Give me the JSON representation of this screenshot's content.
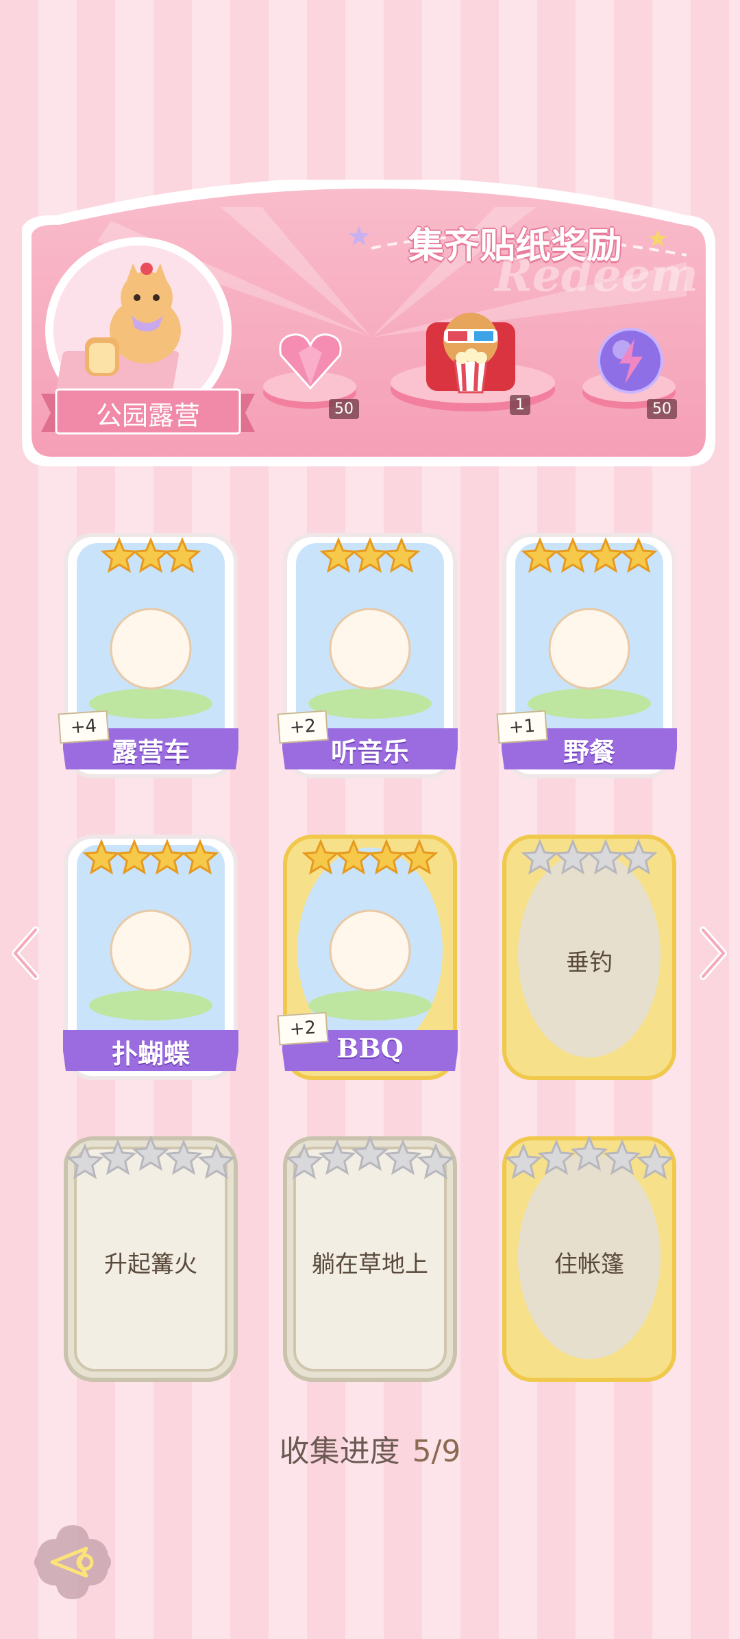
{
  "banner": {
    "title": "集齐贴纸奖励",
    "watermark": "Redeem",
    "theme_name": "公园露营",
    "rewards": [
      {
        "icon": "pink-diamond-heart-icon",
        "count": "50"
      },
      {
        "icon": "cinema-cat-popcorn-icon",
        "count": "1"
      },
      {
        "icon": "lightning-orb-icon",
        "count": "50"
      }
    ]
  },
  "stickers": [
    {
      "name": "露营车",
      "stars": 3,
      "collected": true,
      "bonus": "+4",
      "image": "camper-car-illustration",
      "frame": "white"
    },
    {
      "name": "听音乐",
      "stars": 3,
      "collected": true,
      "bonus": "+2",
      "image": "bunny-headphones-illustration",
      "frame": "white"
    },
    {
      "name": "野餐",
      "stars": 4,
      "collected": true,
      "bonus": "+1",
      "image": "cat-picnic-illustration",
      "frame": "white"
    },
    {
      "name": "扑蝴蝶",
      "stars": 4,
      "collected": true,
      "bonus": "",
      "image": "bear-butterfly-net-illustration",
      "frame": "white"
    },
    {
      "name": "BBQ",
      "stars": 4,
      "collected": true,
      "bonus": "+2",
      "image": "cat-bbq-illustration",
      "frame": "gold"
    },
    {
      "name": "垂钓",
      "stars": 4,
      "collected": false,
      "bonus": "",
      "image": "",
      "frame": "gold"
    },
    {
      "name": "升起篝火",
      "stars": 5,
      "collected": false,
      "bonus": "",
      "image": "",
      "frame": "cream"
    },
    {
      "name": "躺在草地上",
      "stars": 5,
      "collected": false,
      "bonus": "",
      "image": "",
      "frame": "cream"
    },
    {
      "name": "住帐篷",
      "stars": 5,
      "collected": false,
      "bonus": "",
      "image": "",
      "frame": "gold"
    }
  ],
  "progress": {
    "label": "收集进度",
    "value": "5/9",
    "collected": 5,
    "total": 9
  },
  "nav": {
    "prev": "chevron-left-icon",
    "next": "chevron-right-icon",
    "back": "back-arrow-icon"
  },
  "colors": {
    "bg_pink": "#fbd6df",
    "banner_pink": "#f7a9bd",
    "label_purple": "#9b6ce0",
    "gold": "#f3d56a"
  }
}
